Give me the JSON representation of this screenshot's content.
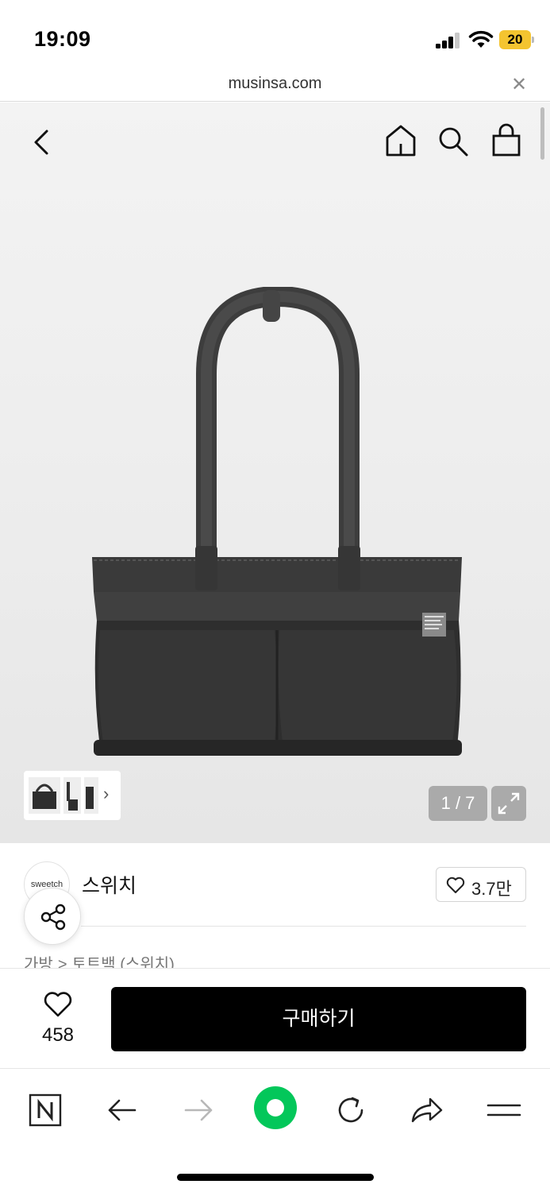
{
  "status_bar": {
    "time": "19:09",
    "battery": "20"
  },
  "browser": {
    "url": "musinsa.com"
  },
  "hero": {
    "counter": "1 / 7",
    "icons": [
      "back-icon",
      "home-icon",
      "search-icon",
      "shopping-bag-icon",
      "expand-icon"
    ],
    "product_image": "black padded shoulder tote bag with two front pockets",
    "label_text": "sweetch"
  },
  "brand": {
    "logo_text": "sweetch",
    "name": "스위치",
    "likes": "3.7만"
  },
  "breadcrumb": {
    "category": "가방",
    "separator": ">",
    "sub": "토트백 (스위치)"
  },
  "purchase": {
    "like_count": "458",
    "buy_label": "구매하기"
  },
  "colors": {
    "accent_green": "#03c75a",
    "buy_button": "#000000",
    "battery": "#f4c430"
  }
}
